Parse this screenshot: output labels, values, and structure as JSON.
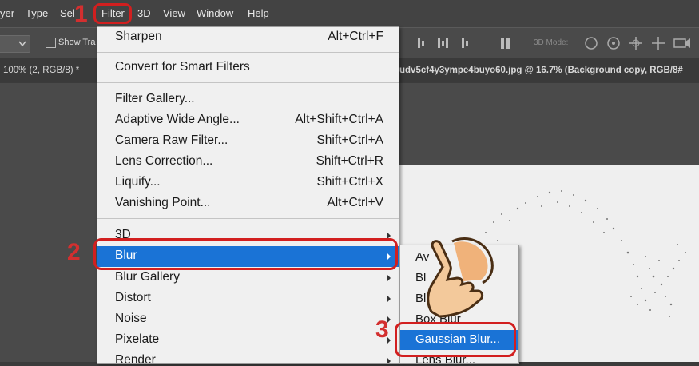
{
  "menubar": {
    "items": [
      "yer",
      "Type",
      "Sel",
      "Filter",
      "3D",
      "View",
      "Window",
      "Help"
    ]
  },
  "options_bar": {
    "show_transform": "Show Tra",
    "mode_3d": "3D Mode:"
  },
  "tabs": {
    "left_doc": "100% (2, RGB/8) *",
    "right_doc": "udv5cf4y3ympe4buyo60.jpg @ 16.7% (Background copy, RGB/8#"
  },
  "filter_menu": {
    "items": [
      {
        "label": "Sharpen",
        "shortcut": "Alt+Ctrl+F"
      },
      {
        "label": "Convert for Smart Filters",
        "shortcut": ""
      },
      {
        "label": "Filter Gallery...",
        "shortcut": ""
      },
      {
        "label": "Adaptive Wide Angle...",
        "shortcut": "Alt+Shift+Ctrl+A"
      },
      {
        "label": "Camera Raw Filter...",
        "shortcut": "Shift+Ctrl+A"
      },
      {
        "label": "Lens Correction...",
        "shortcut": "Shift+Ctrl+R"
      },
      {
        "label": "Liquify...",
        "shortcut": "Shift+Ctrl+X"
      },
      {
        "label": "Vanishing Point...",
        "shortcut": "Alt+Ctrl+V"
      },
      {
        "label": "3D",
        "shortcut": ""
      },
      {
        "label": "Blur",
        "shortcut": ""
      },
      {
        "label": "Blur Gallery",
        "shortcut": ""
      },
      {
        "label": "Distort",
        "shortcut": ""
      },
      {
        "label": "Noise",
        "shortcut": ""
      },
      {
        "label": "Pixelate",
        "shortcut": ""
      },
      {
        "label": "Render",
        "shortcut": ""
      }
    ]
  },
  "blur_submenu": {
    "items": [
      "Av",
      "Bl",
      "Bl",
      "Box Blur",
      "Gaussian Blur...",
      "Lens Blur..."
    ]
  },
  "steps": [
    "1",
    "2",
    "3"
  ],
  "colors": {
    "highlight": "#1a73d6",
    "annotation_red": "#d21f1f",
    "menu_bg": "#f0f0f0"
  }
}
